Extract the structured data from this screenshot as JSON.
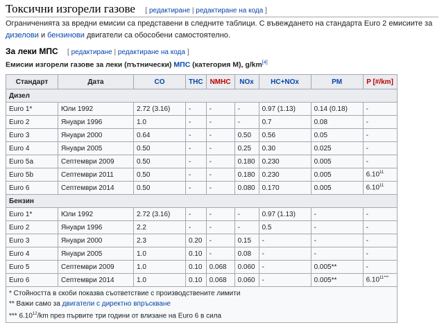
{
  "heading": {
    "title": "Токсични изгорели газове",
    "edit_open": "[ ",
    "edit_label": "редактиране",
    "edit_sep": " | ",
    "edit_code_label": "редактиране на кода",
    "edit_close": " ]"
  },
  "intro": {
    "text_1": "Ограниченията за вредни емисии са представени в следните таблици. С въвеждането на стандарта Euro 2 емисиите за ",
    "link_diesel": "дизелови",
    "text_2": " и ",
    "link_petrol": "бензинови",
    "text_3": " двигатели са обособени самостоятелно."
  },
  "subheading": {
    "title": "За леки МПС",
    "edit_open": "[ ",
    "edit_label": "редактиране",
    "edit_sep": " | ",
    "edit_code_label": "редактиране на кода",
    "edit_close": " ]"
  },
  "caption": {
    "text_1": "Емисии изгорели газове за леки (пътнически) ",
    "link": "МПС",
    "text_2": " (категория M), g/km",
    "ref": "[4]"
  },
  "table": {
    "headers": [
      "Стандарт",
      "Дата",
      "CO",
      "THC",
      "NMHC",
      "NOx",
      "HC+NOx",
      "PM",
      "P [#/km]"
    ],
    "section_diesel": "Дизел",
    "diesel_rows": [
      [
        "Euro 1*",
        "Юли 1992",
        "2.72 (3.16)",
        "-",
        "-",
        "-",
        "0.97 (1.13)",
        "0.14 (0.18)",
        "-"
      ],
      [
        "Euro 2",
        "Януари 1996",
        "1.0",
        "-",
        "-",
        "-",
        "0.7",
        "0.08",
        "-"
      ],
      [
        "Euro 3",
        "Януари 2000",
        "0.64",
        "-",
        "-",
        "0.50",
        "0.56",
        "0.05",
        "-"
      ],
      [
        "Euro 4",
        "Януари 2005",
        "0.50",
        "-",
        "-",
        "0.25",
        "0.30",
        "0.025",
        "-"
      ],
      [
        "Euro 5a",
        "Септември 2009",
        "0.50",
        "-",
        "-",
        "0.180",
        "0.230",
        "0.005",
        "-"
      ],
      [
        "Euro 5b",
        "Септември 2011",
        "0.50",
        "-",
        "-",
        "0.180",
        "0.230",
        "0.005",
        "6.10"
      ],
      [
        "Euro 6",
        "Септември 2014",
        "0.50",
        "-",
        "-",
        "0.080",
        "0.170",
        "0.005",
        "6.10"
      ]
    ],
    "diesel_p_exp": "11",
    "section_petrol": "Бензин",
    "petrol_rows": [
      [
        "Euro 1*",
        "Юли 1992",
        "2.72 (3.16)",
        "-",
        "-",
        "-",
        "0.97 (1.13)",
        "-",
        "-"
      ],
      [
        "Euro 2",
        "Януари 1996",
        "2.2",
        "-",
        "-",
        "-",
        "0.5",
        "-",
        "-"
      ],
      [
        "Euro 3",
        "Януари 2000",
        "2.3",
        "0.20",
        "-",
        "0.15",
        "-",
        "-",
        "-"
      ],
      [
        "Euro 4",
        "Януари 2005",
        "1.0",
        "0.10",
        "-",
        "0.08",
        "-",
        "-",
        "-"
      ],
      [
        "Euro 5",
        "Септември 2009",
        "1.0",
        "0.10",
        "0.068",
        "0.060",
        "-",
        "0.005**",
        "-"
      ],
      [
        "Euro 6",
        "Септември 2014",
        "1.0",
        "0.10",
        "0.068",
        "0.060",
        "-",
        "0.005**",
        "6.10"
      ]
    ],
    "petrol_p_exp": "11",
    "petrol_p_suffix": "***"
  },
  "footnotes": {
    "note_1": "* Стойността в скоби показва съответствие с производствените лимити",
    "note_2_text": "** Важи само за ",
    "note_2_link": "двигатели с директно впръскване",
    "note_3_a": "*** 6.10",
    "note_3_exp": "12",
    "note_3_b": "/km през първите три години от влизане на Euro 6 в сила"
  }
}
